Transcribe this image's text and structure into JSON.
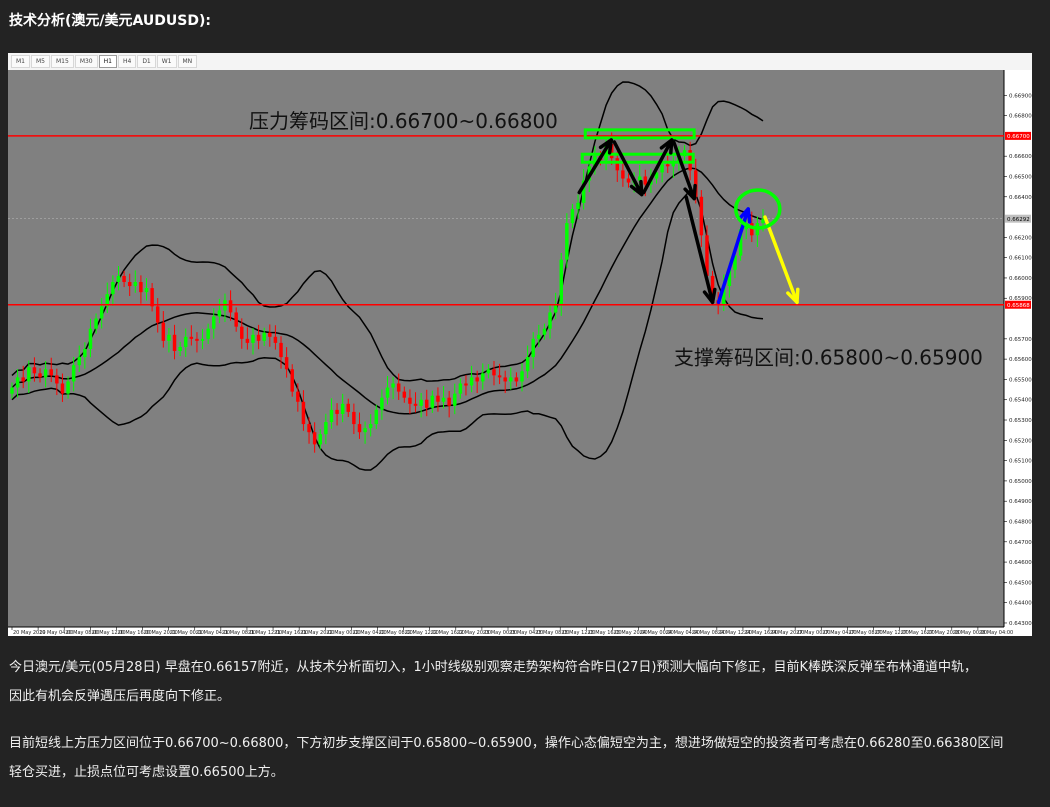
{
  "heading": "技术分析(澳元/美元AUDUSD):",
  "toolbar": {
    "timeframes": [
      "M1",
      "M5",
      "M15",
      "M30",
      "H1",
      "H4",
      "D1",
      "W1",
      "MN"
    ],
    "active": "H1"
  },
  "chart_data": {
    "type": "candlestick",
    "symbol": "AUDUSD",
    "timeframe": "H1",
    "ylim": [
      0.6429,
      0.67
    ],
    "y_ticks": [
      "0.66900",
      "0.66800",
      "0.66600",
      "0.66500",
      "0.66400",
      "0.66200",
      "0.66100",
      "0.66000",
      "0.65900",
      "0.65700",
      "0.65600",
      "0.65500",
      "0.65400",
      "0.65300",
      "0.65200",
      "0.65100",
      "0.65000",
      "0.64900",
      "0.64800",
      "0.64700",
      "0.64600",
      "0.64500",
      "0.64400",
      "0.64300"
    ],
    "x_ticks": [
      "20 May 2019",
      "20 May 04:00",
      "20 May 08:00",
      "20 May 12:00",
      "20 May 16:00",
      "20 May 20:00",
      "21 May 00:00",
      "21 May 04:00",
      "21 May 08:00",
      "21 May 12:00",
      "21 May 16:00",
      "21 May 20:00",
      "22 May 00:00",
      "22 May 04:00",
      "22 May 08:00",
      "22 May 12:00",
      "22 May 16:00",
      "22 May 20:00",
      "23 May 00:00",
      "23 May 04:00",
      "23 May 08:00",
      "23 May 12:00",
      "23 May 16:00",
      "23 May 20:00",
      "24 May 00:00",
      "24 May 04:00",
      "24 May 08:00",
      "24 May 12:00",
      "24 May 16:00",
      "24 May 20:00",
      "27 May 00:00",
      "27 May 04:00",
      "27 May 08:00",
      "27 May 12:00",
      "27 May 16:00",
      "27 May 20:00",
      "28 May 00:00",
      "28 May 04:00"
    ],
    "price_labels": {
      "resistance": "0.66700",
      "current": "0.66292",
      "support": "0.65868"
    },
    "resistance_level": 0.667,
    "current_price": 0.66292,
    "support_level": 0.65868,
    "closes": [
      0.6546,
      0.6551,
      0.6549,
      0.6556,
      0.6553,
      0.6551,
      0.6555,
      0.6552,
      0.6548,
      0.6543,
      0.6549,
      0.6557,
      0.6561,
      0.6565,
      0.6575,
      0.658,
      0.6586,
      0.6592,
      0.6598,
      0.6601,
      0.6598,
      0.6596,
      0.6598,
      0.6593,
      0.6595,
      0.6586,
      0.6578,
      0.6569,
      0.6572,
      0.6564,
      0.6566,
      0.6571,
      0.657,
      0.6569,
      0.657,
      0.6575,
      0.6581,
      0.6584,
      0.6589,
      0.6583,
      0.6576,
      0.657,
      0.6568,
      0.6572,
      0.6569,
      0.6573,
      0.6571,
      0.6568,
      0.6561,
      0.6555,
      0.6544,
      0.6539,
      0.6528,
      0.6524,
      0.6518,
      0.6523,
      0.6529,
      0.6535,
      0.6533,
      0.6538,
      0.6534,
      0.6528,
      0.6524,
      0.6526,
      0.6528,
      0.6535,
      0.6541,
      0.6546,
      0.6548,
      0.6544,
      0.6541,
      0.6538,
      0.6537,
      0.654,
      0.6536,
      0.6542,
      0.6539,
      0.6541,
      0.6537,
      0.6543,
      0.6548,
      0.6547,
      0.6551,
      0.6549,
      0.6553,
      0.6555,
      0.6552,
      0.6551,
      0.6549,
      0.6551,
      0.6549,
      0.6554,
      0.6561,
      0.657,
      0.6572,
      0.6575,
      0.6583,
      0.6587,
      0.6609,
      0.6627,
      0.6634,
      0.6637,
      0.6648,
      0.6655,
      0.666,
      0.6658,
      0.6666,
      0.6659,
      0.6653,
      0.6649,
      0.6647,
      0.6648,
      0.665,
      0.6646,
      0.6649,
      0.6652,
      0.6656,
      0.6655,
      0.6657,
      0.666,
      0.6663,
      0.6653,
      0.664,
      0.6621,
      0.6601,
      0.6589,
      0.6587,
      0.6596,
      0.6604,
      0.6611,
      0.6624,
      0.6627,
      0.6621,
      0.6627,
      0.6629
    ],
    "annotations": {
      "resistance_label": "压力筹码区间:0.66700~0.66800",
      "support_label": "支撑筹码区间:0.65800~0.65900"
    }
  },
  "paragraphs": [
    [
      "今日澳元/美元(05月28日) 早盘在0.66157附近，从技术分析面切入，1小时线级别观察走势架构符合昨日(27日)预测大幅向下修正，目前K棒跌深反弹至布林通道中轨，",
      "因此有机会反弹遇压后再度向下修正。"
    ],
    [
      "目前短线上方压力区间位于0.66700~0.66800，下方初步支撑区间于0.65800~0.65900，操作心态偏短空为主，想进场做短空的投资者可考虑在0.66280至0.66380区间",
      "轻仓买进，止损点位可考虑设置0.66500上方。"
    ]
  ],
  "colors": {
    "page_bg": "#232323",
    "chart_bg": "#808080",
    "bull": "#00ff00",
    "bear": "#ff0000",
    "level_line": "#ff0000",
    "box": "#00ff00",
    "arrow_down": "#000000",
    "arrow_up": "#0000ff",
    "arrow_forecast": "#ffff00"
  }
}
